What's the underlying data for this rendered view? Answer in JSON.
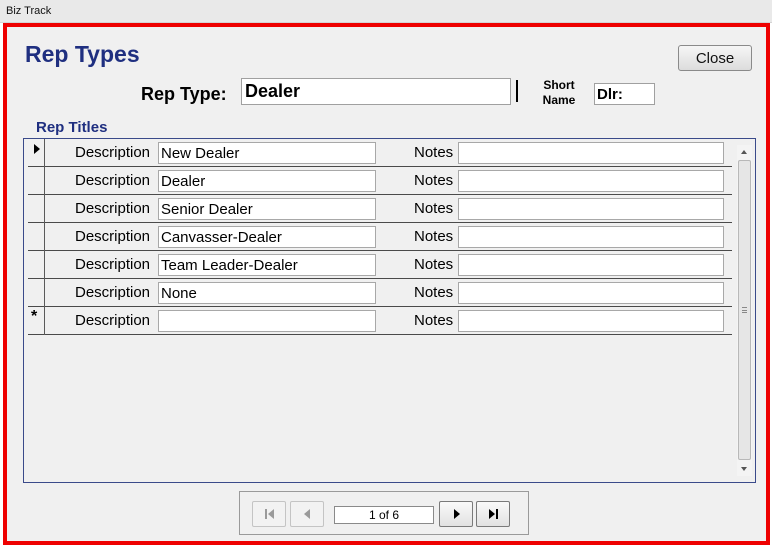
{
  "window": {
    "title": "Biz Track"
  },
  "form": {
    "title": "Rep Types",
    "close_label": "Close",
    "rep_type_label": "Rep Type:",
    "rep_type_value": "Dealer",
    "short_name_label": "Short Name",
    "short_name_value": "Dlr:",
    "section_label": "Rep Titles"
  },
  "subform": {
    "description_label": "Description",
    "notes_label": "Notes",
    "rows": [
      {
        "description": "New Dealer",
        "notes": ""
      },
      {
        "description": "Dealer",
        "notes": ""
      },
      {
        "description": "Senior Dealer",
        "notes": ""
      },
      {
        "description": "Canvasser-Dealer",
        "notes": ""
      },
      {
        "description": "Team Leader-Dealer",
        "notes": ""
      },
      {
        "description": "None",
        "notes": ""
      },
      {
        "description": "",
        "notes": ""
      }
    ],
    "current_row_icon": "record-selector-current-icon",
    "new_row_icon": "new-record-asterisk-icon",
    "new_row_glyph": "*"
  },
  "navigation": {
    "record_text": "1 of 6",
    "icons": [
      "first-record-icon",
      "previous-record-icon",
      "next-record-icon",
      "last-record-icon"
    ]
  },
  "colors": {
    "frame_border": "#ee0000",
    "title_text": "#1f2f80",
    "background": "#f0f0f0"
  }
}
